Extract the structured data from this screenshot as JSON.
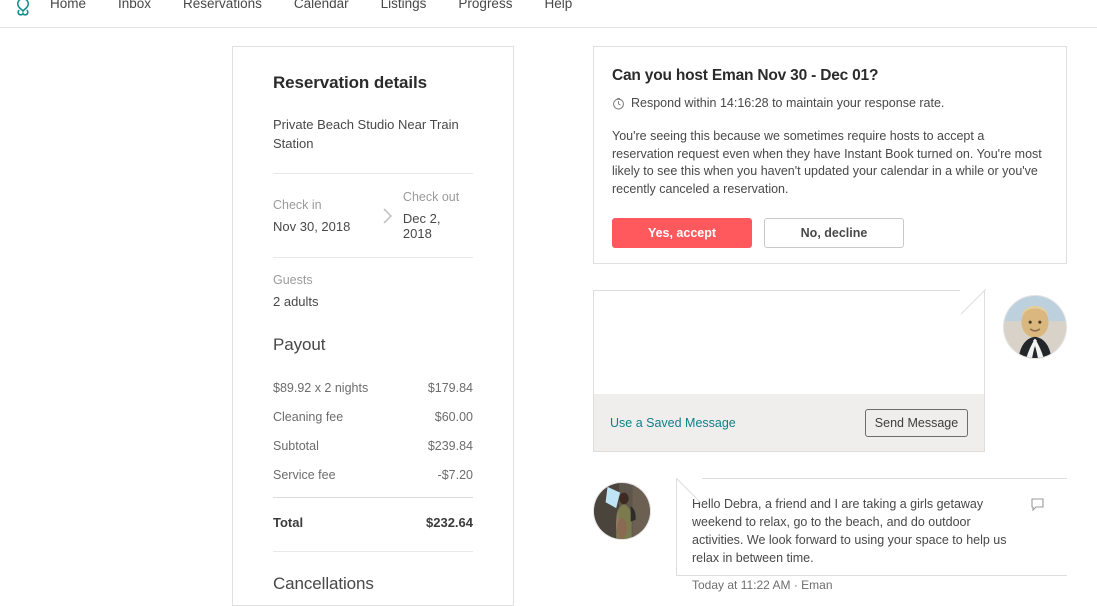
{
  "nav": {
    "logo_icon": "airbnb-belo-logo",
    "logo_color": "#0e8a8a",
    "items": [
      {
        "label": "Home"
      },
      {
        "label": "Inbox"
      },
      {
        "label": "Reservations"
      },
      {
        "label": "Calendar"
      },
      {
        "label": "Listings"
      },
      {
        "label": "Progress"
      },
      {
        "label": "Help"
      }
    ]
  },
  "reservation": {
    "title": "Reservation details",
    "listing_name": "Private Beach Studio Near Train Station",
    "check_in_label": "Check in",
    "check_in_value": "Nov 30, 2018",
    "check_out_label": "Check out",
    "check_out_value": "Dec 2, 2018",
    "arrow_icon": "chevron-right-icon",
    "guests_label": "Guests",
    "guests_value": "2 adults"
  },
  "payout": {
    "title": "Payout",
    "rows": [
      {
        "label": "$89.92 x 2 nights",
        "amount": "$179.84"
      },
      {
        "label": "Cleaning fee",
        "amount": "$60.00"
      },
      {
        "label": "Subtotal",
        "amount": "$239.84"
      },
      {
        "label": "Service fee",
        "amount": "-$7.20"
      }
    ],
    "total_label": "Total",
    "total_amount": "$232.64"
  },
  "cancellations": {
    "title": "Cancellations"
  },
  "request": {
    "title": "Can you host Eman Nov 30 - Dec 01?",
    "clock_icon": "clock-icon",
    "respond_text": "Respond within 14:16:28 to maintain your response rate.",
    "body": "You're seeing this because we sometimes require hosts to accept a reservation request even when they have Instant Book turned on. You're most likely to see this when you haven't updated your calendar in a while or you've recently canceled a reservation.",
    "accept_label": "Yes, accept",
    "accept_color": "#ff585d",
    "decline_label": "No, decline"
  },
  "compose": {
    "message_value": "",
    "saved_message_link": "Use a Saved Message",
    "saved_message_color": "#0f7f87",
    "send_label": "Send Message",
    "host_avatar": "host-avatar-photo"
  },
  "guest_message": {
    "avatar": "guest-avatar-photo",
    "text": "Hello Debra, a friend and I are taking a girls getaway weekend to relax, go to the beach, and do outdoor activities. We look forward to using your space to help us relax in between time.",
    "meta": "Today at 11:22 AM · Eman",
    "report_icon": "flag-icon"
  }
}
